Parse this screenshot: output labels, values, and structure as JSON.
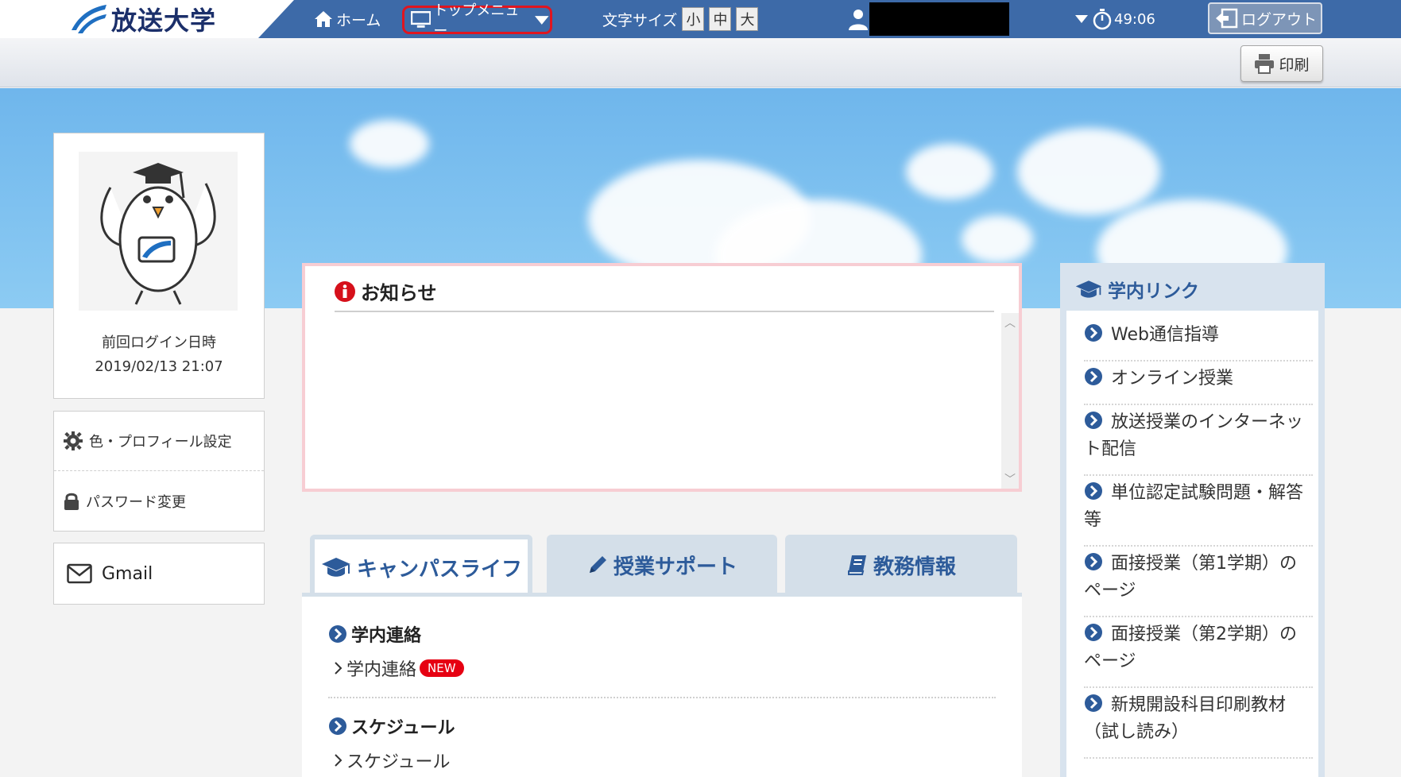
{
  "header": {
    "logo_text": "放送大学",
    "nav_home": "ホーム",
    "nav_topmenu": "トップメニュー",
    "fontsize_label": "文字サイズ",
    "fontsize_small": "小",
    "fontsize_medium": "中",
    "fontsize_large": "大",
    "timer": "49:06",
    "logout": "ログアウト"
  },
  "toolbar": {
    "print": "印刷"
  },
  "profile": {
    "last_login_label": "前回ログイン日時",
    "last_login_value": "2019/02/13 21:07"
  },
  "settings": {
    "color_profile": "色・プロフィール設定",
    "password_change": "パスワード変更"
  },
  "gmail": {
    "label": "Gmail"
  },
  "notice": {
    "title": "お知らせ"
  },
  "tabs": [
    {
      "label": "キャンパスライフ",
      "icon": "graduation-cap-icon",
      "active": true
    },
    {
      "label": "授業サポート",
      "icon": "pencil-icon",
      "active": false
    },
    {
      "label": "教務情報",
      "icon": "book-icon",
      "active": false
    }
  ],
  "campus": {
    "sections": [
      {
        "heading": "学内連絡",
        "link": "学内連絡",
        "badge": "NEW"
      },
      {
        "heading": "スケジュール",
        "link": "スケジュール"
      }
    ]
  },
  "links_panel": {
    "title": "学内リンク",
    "items": [
      {
        "line1": "Web通信指導",
        "line2": ""
      },
      {
        "line1": "オンライン授業",
        "line2": ""
      },
      {
        "line1": "放送授業のインターネッ",
        "line2": "ト配信"
      },
      {
        "line1": "単位認定試験問題・解答",
        "line2": "等"
      },
      {
        "line1": "面接授業（第1学期）の",
        "line2": "ページ"
      },
      {
        "line1": "面接授業（第2学期）の",
        "line2": "ページ"
      },
      {
        "line1": "新規開設科目印刷教材",
        "line2": "（試し読み）"
      }
    ]
  },
  "colors": {
    "header_blue": "#3d6aa8",
    "accent_blue": "#2d5b9a",
    "highlight_red": "#e0151f",
    "notice_border": "#f7cdd3",
    "new_badge": "#e60012"
  }
}
